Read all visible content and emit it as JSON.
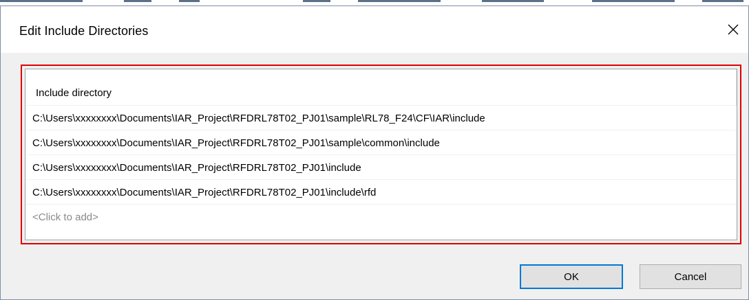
{
  "dialog": {
    "title": "Edit Include Directories",
    "close_icon": "close-icon"
  },
  "list": {
    "column_header": "Include directory",
    "rows": [
      "C:\\Users\\xxxxxxxx\\Documents\\IAR_Project\\RFDRL78T02_PJ01\\sample\\RL78_F24\\CF\\IAR\\include",
      "C:\\Users\\xxxxxxxx\\Documents\\IAR_Project\\RFDRL78T02_PJ01\\sample\\common\\include",
      "C:\\Users\\xxxxxxxx\\Documents\\IAR_Project\\RFDRL78T02_PJ01\\include",
      "C:\\Users\\xxxxxxxx\\Documents\\IAR_Project\\RFDRL78T02_PJ01\\include\\rfd"
    ],
    "add_placeholder": "<Click to add>"
  },
  "buttons": {
    "ok_label": "OK",
    "cancel_label": "Cancel"
  },
  "colors": {
    "highlight_border": "#e00000",
    "ok_focus_border": "#0078d7",
    "placeholder_text": "#8a8a8a"
  }
}
